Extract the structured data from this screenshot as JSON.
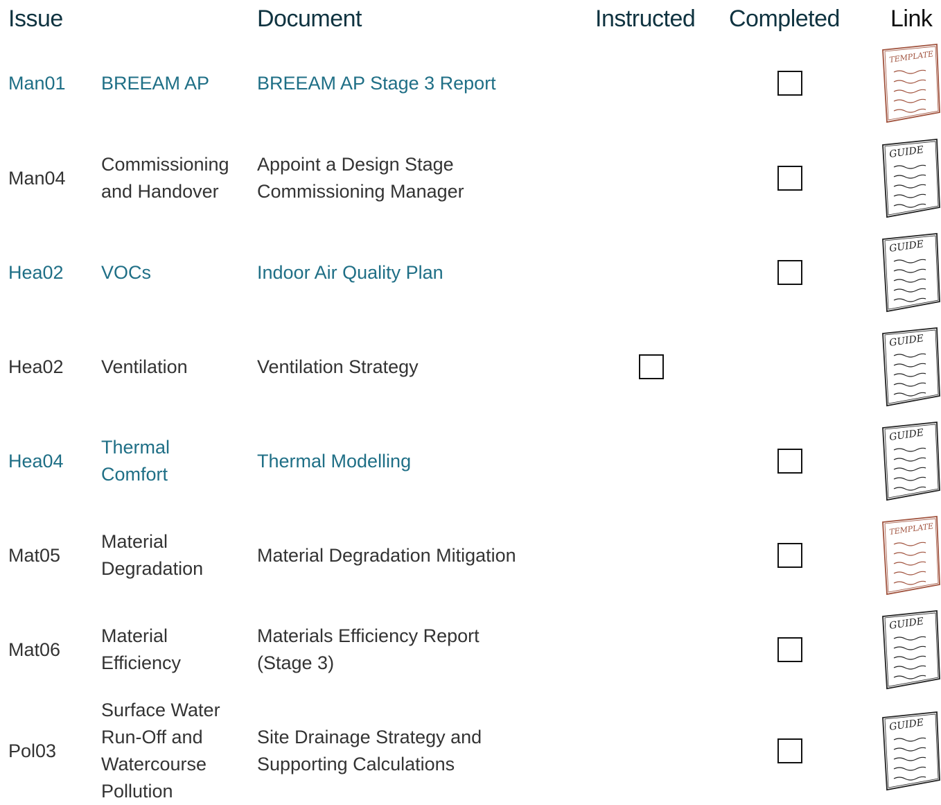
{
  "headers": {
    "issue": "Issue",
    "document": "Document",
    "instructed": "Instructed",
    "completed": "Completed",
    "link": "Link"
  },
  "rows": [
    {
      "code": "Man01",
      "lines_sub": [
        "BREEAM AP"
      ],
      "lines_doc": [
        "BREEAM AP Stage 3 Report"
      ],
      "highlight": true,
      "instructed_box": false,
      "completed_box": true,
      "link_type": "template",
      "link_label": "TEMPLATE"
    },
    {
      "code": "Man04",
      "lines_sub": [
        "Commissioning",
        "and Handover"
      ],
      "lines_doc": [
        "Appoint a Design Stage",
        "Commissioning Manager"
      ],
      "highlight": false,
      "instructed_box": false,
      "completed_box": true,
      "link_type": "guide",
      "link_label": "GUIDE"
    },
    {
      "code": "Hea02",
      "lines_sub": [
        "VOCs"
      ],
      "lines_doc": [
        "Indoor Air Quality Plan"
      ],
      "highlight": true,
      "instructed_box": false,
      "completed_box": true,
      "link_type": "guide",
      "link_label": "GUIDE"
    },
    {
      "code": "Hea02",
      "lines_sub": [
        "Ventilation"
      ],
      "lines_doc": [
        "Ventilation Strategy"
      ],
      "highlight": false,
      "instructed_box": true,
      "completed_box": false,
      "link_type": "guide",
      "link_label": "GUIDE"
    },
    {
      "code": "Hea04",
      "lines_sub": [
        "Thermal",
        "Comfort"
      ],
      "lines_doc": [
        "Thermal Modelling"
      ],
      "highlight": true,
      "instructed_box": false,
      "completed_box": true,
      "link_type": "guide",
      "link_label": "GUIDE"
    },
    {
      "code": "Mat05",
      "lines_sub": [
        "Material",
        "Degradation"
      ],
      "lines_doc": [
        "Material Degradation Mitigation"
      ],
      "highlight": false,
      "instructed_box": false,
      "completed_box": true,
      "link_type": "template",
      "link_label": "TEMPLATE"
    },
    {
      "code": "Mat06",
      "lines_sub": [
        "Material",
        "Efficiency"
      ],
      "lines_doc": [
        "Materials Efficiency Report",
        "(Stage 3)"
      ],
      "highlight": false,
      "instructed_box": false,
      "completed_box": true,
      "link_type": "guide",
      "link_label": "GUIDE"
    },
    {
      "code": "Pol03",
      "lines_sub": [
        "Surface Water",
        "Run-Off and",
        "Watercourse",
        "Pollution"
      ],
      "lines_doc": [
        "Site Drainage Strategy and",
        "Supporting Calculations"
      ],
      "highlight": false,
      "instructed_box": false,
      "completed_box": true,
      "link_type": "guide",
      "link_label": "GUIDE"
    }
  ],
  "colors": {
    "highlight_text": "#1f6f86",
    "header_text": "#0f3340",
    "template_icon": "#a0523d",
    "guide_icon": "#222222"
  }
}
